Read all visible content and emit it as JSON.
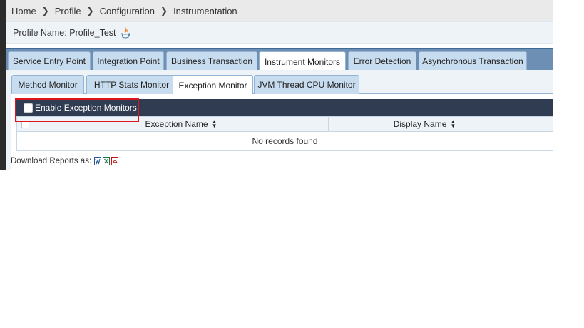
{
  "breadcrumb": {
    "items": [
      "Home",
      "Profile",
      "Configuration",
      "Instrumentation"
    ]
  },
  "profile": {
    "label": "Profile Name: Profile_Test"
  },
  "outer_tabs": [
    {
      "label": "Service Entry Point",
      "active": false
    },
    {
      "label": "Integration Point",
      "active": false
    },
    {
      "label": "Business Transaction",
      "active": false
    },
    {
      "label": "Instrument Monitors",
      "active": true
    },
    {
      "label": "Error Detection",
      "active": false
    },
    {
      "label": "Asynchronous Transaction",
      "active": false
    }
  ],
  "inner_tabs": [
    {
      "label": "Method Monitor",
      "active": false
    },
    {
      "label": "HTTP Stats Monitor",
      "active": false
    },
    {
      "label": "Exception Monitor",
      "active": true
    },
    {
      "label": "JVM Thread CPU Monitor",
      "active": false
    }
  ],
  "enable": {
    "label": "Enable Exception Monitors",
    "checked": false
  },
  "grid": {
    "columns": [
      "Exception Name",
      "Display Name"
    ],
    "empty_message": "No records found"
  },
  "download": {
    "label": "Download Reports as:",
    "icons": [
      "word-icon",
      "excel-icon",
      "pdf-icon"
    ]
  },
  "colors": {
    "header_dark": "#2f3c52",
    "tab_bar": "#6d8fb3",
    "highlight": "#e0161f"
  }
}
